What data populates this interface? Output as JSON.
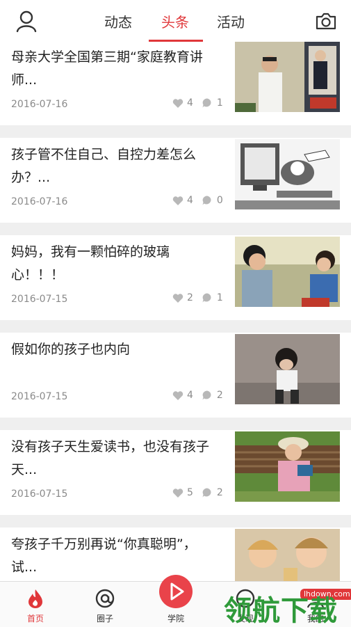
{
  "header": {
    "tabs": [
      {
        "label": "动态"
      },
      {
        "label": "头条"
      },
      {
        "label": "活动"
      }
    ],
    "active_tab": "头条",
    "accent_color": "#e0373a"
  },
  "feed": {
    "items": [
      {
        "title": "母亲大学全国第三期“家庭教育讲师...",
        "date": "2016-07-16",
        "likes": "4",
        "comments": "1"
      },
      {
        "title": "孩子管不住自己、自控力差怎么办？...",
        "date": "2016-07-16",
        "likes": "4",
        "comments": "0"
      },
      {
        "title": "妈妈，我有一颗怕碎的玻璃心！！！",
        "date": "2016-07-15",
        "likes": "2",
        "comments": "1"
      },
      {
        "title": "假如你的孩子也内向",
        "date": "2016-07-15",
        "likes": "4",
        "comments": "2"
      },
      {
        "title": "没有孩子天生爱读书，也没有孩子天...",
        "date": "2016-07-15",
        "likes": "5",
        "comments": "2"
      },
      {
        "title": "夸孩子千万别再说“你真聪明”，试...",
        "date": "",
        "likes": "",
        "comments": ""
      }
    ]
  },
  "bottom_nav": {
    "items": [
      {
        "label": "首页"
      },
      {
        "label": "圈子"
      },
      {
        "label": "学院"
      },
      {
        "label": "发现"
      },
      {
        "label": "我的"
      }
    ]
  },
  "watermark": {
    "brand": "领航下载",
    "url": "lhdown.com"
  }
}
